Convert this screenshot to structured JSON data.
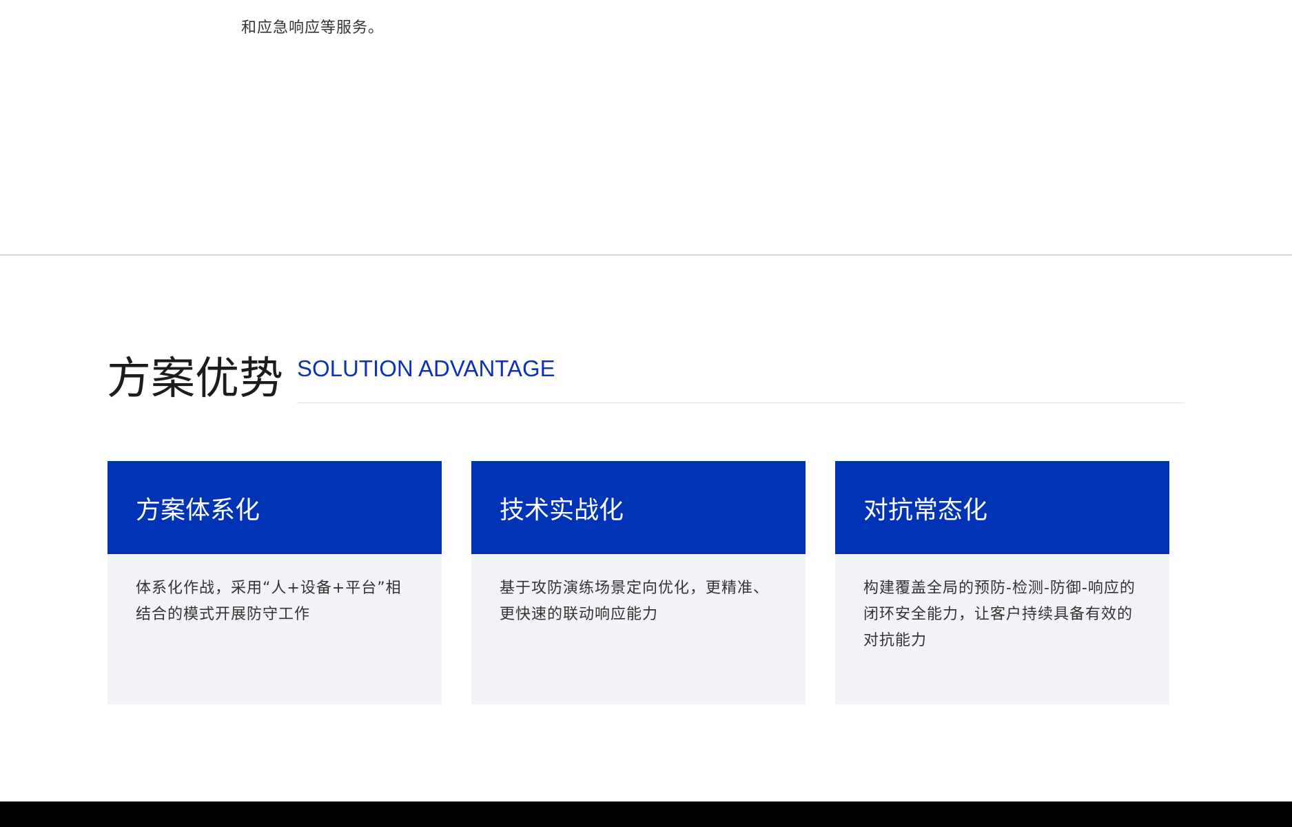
{
  "intro": {
    "trailing_text": "和应急响应等服务。"
  },
  "advantage": {
    "title_cn": "方案优势",
    "title_en": "SOLUTION ADVANTAGE",
    "cards": [
      {
        "title": "方案体系化",
        "desc": "体系化作战，采用“人+设备+平台”相结合的模式开展防守工作"
      },
      {
        "title": "技术实战化",
        "desc": "基于攻防演练场景定向优化，更精准、更快速的联动响应能力"
      },
      {
        "title": "对抗常态化",
        "desc": "构建覆盖全局的预防-检测-防御-响应的闭环安全能力，让客户持续具备有效的对抗能力"
      }
    ]
  },
  "colors": {
    "accent_blue": "#0033b5",
    "english_title_blue": "#0d32b4",
    "card_body_bg": "#f2f3f7",
    "footer_bg": "#000000"
  }
}
